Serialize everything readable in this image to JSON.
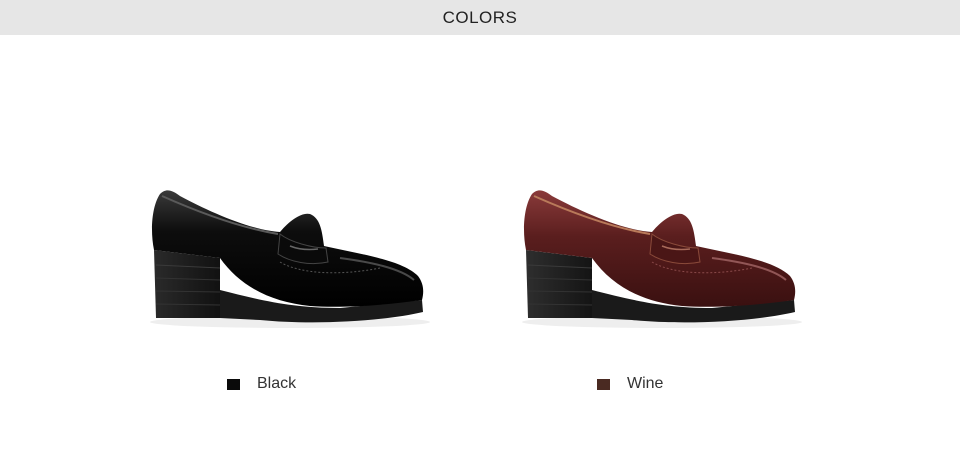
{
  "header": {
    "title": "COLORS"
  },
  "colors": [
    {
      "label": "Black",
      "swatch": "#0a0a0a",
      "shoe": "black-loafer-image"
    },
    {
      "label": "Wine",
      "swatch": "#4a2a22",
      "shoe": "wine-loafer-image"
    }
  ]
}
